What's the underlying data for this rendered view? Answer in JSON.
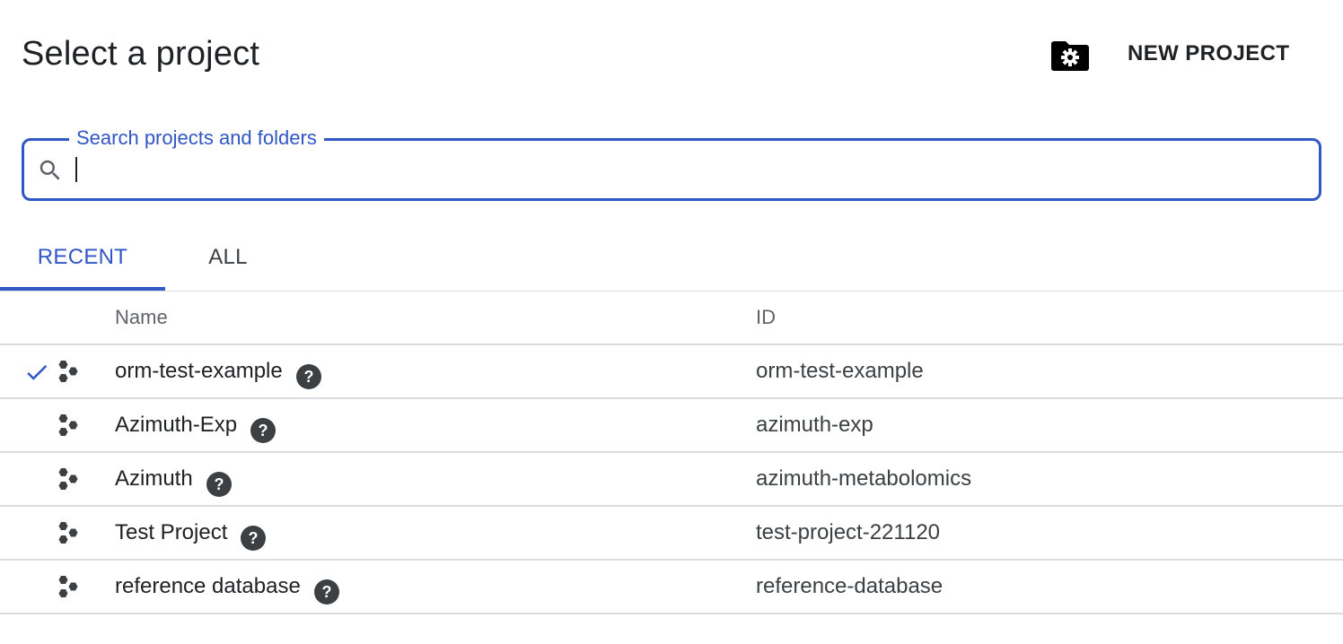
{
  "dialog": {
    "title": "Select a project",
    "manage_icon": "folder-gear-icon",
    "new_project_label": "NEW PROJECT"
  },
  "search": {
    "label": "Search projects and folders",
    "value": "",
    "placeholder": ""
  },
  "tabs": [
    {
      "label": "RECENT",
      "active": true
    },
    {
      "label": "ALL",
      "active": false
    }
  ],
  "table": {
    "headers": {
      "name": "Name",
      "id": "ID"
    },
    "rows": [
      {
        "name": "orm-test-example",
        "id": "orm-test-example",
        "selected": true
      },
      {
        "name": "Azimuth-Exp",
        "id": "azimuth-exp",
        "selected": false
      },
      {
        "name": "Azimuth",
        "id": "azimuth-metabolomics",
        "selected": false
      },
      {
        "name": "Test Project",
        "id": "test-project-221120",
        "selected": false
      },
      {
        "name": "reference database",
        "id": "reference-database",
        "selected": false
      }
    ]
  },
  "colors": {
    "accent": "#3156c5",
    "text": "#202124",
    "divider": "#dadce0",
    "icon": "#3c4043"
  }
}
